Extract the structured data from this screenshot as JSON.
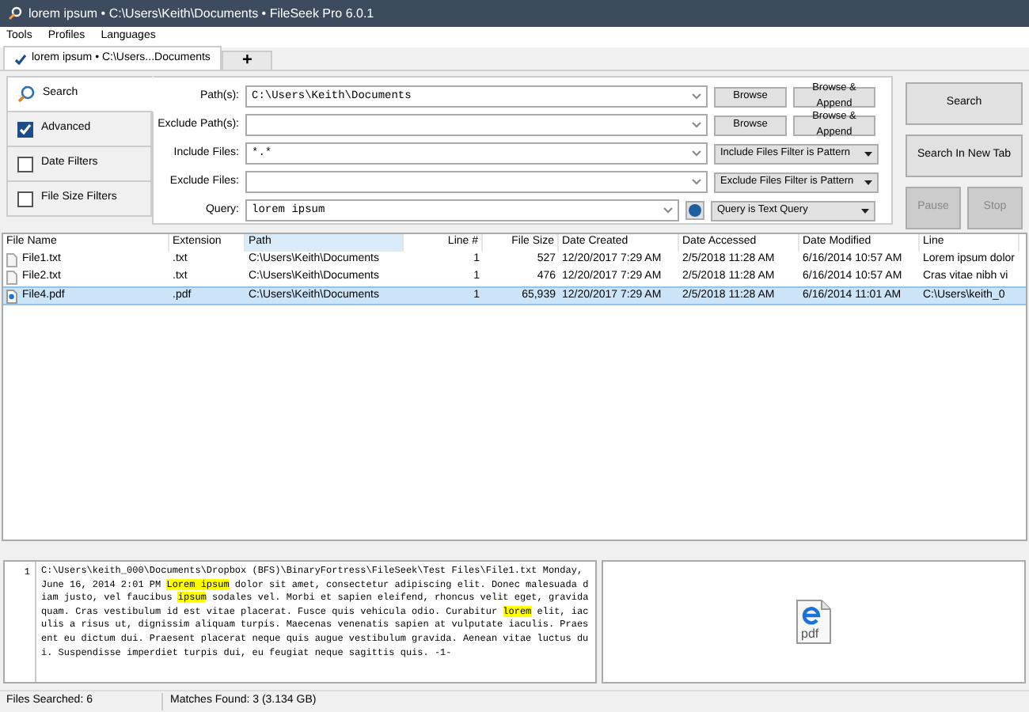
{
  "window": {
    "title": "lorem ipsum • C:\\Users\\Keith\\Documents • FileSeek Pro 6.0.1"
  },
  "menu": [
    "Tools",
    "Profiles",
    "Languages"
  ],
  "tabs": [
    {
      "label": "lorem ipsum • C:\\Users...Documents",
      "selected": true,
      "kind": "search"
    },
    {
      "label": "+",
      "selected": false,
      "kind": "add"
    }
  ],
  "sidebar": {
    "items": [
      {
        "label": "Search",
        "kind": "tab",
        "selected": true
      },
      {
        "label": "Advanced",
        "kind": "check",
        "checked": true
      },
      {
        "label": "Date Filters",
        "kind": "check",
        "checked": false
      },
      {
        "label": "File Size Filters",
        "kind": "check",
        "checked": false
      }
    ]
  },
  "fields": [
    {
      "label": "Path(s):",
      "value": "C:\\Users\\Keith\\Documents",
      "kind": "browse",
      "buttons": [
        "Browse",
        "Browse & Append"
      ]
    },
    {
      "label": "Exclude Path(s):",
      "kind": "browse",
      "buttons": [
        "Browse",
        "Browse & Append"
      ]
    },
    {
      "label": "Include Files:",
      "value": "*.*",
      "kind": "select",
      "option": "Include Files Filter is Pattern"
    },
    {
      "label": "Exclude Files:",
      "kind": "select",
      "option": "Exclude Files Filter is Pattern"
    },
    {
      "label": "Query:",
      "value": "lorem ipsum",
      "kind": "query",
      "option": "Query is Text Query"
    }
  ],
  "actions": [
    {
      "label": "Search",
      "disabled": false
    },
    {
      "label": "Search In New Tab",
      "disabled": false
    },
    {
      "label": "Pause",
      "disabled": true
    },
    {
      "label": "Stop",
      "disabled": true
    }
  ],
  "table": {
    "columns": [
      "File Name",
      "Extension",
      "Path",
      "Line #",
      "File Size",
      "Date Created",
      "Date Accessed",
      "Date Modified",
      "Line"
    ],
    "rows": [
      {
        "cells": [
          "File1.txt",
          ".txt",
          "C:\\Users\\Keith\\Documents",
          "1",
          "527",
          "12/20/2017 7:29 AM",
          "2/5/2018 11:28 AM",
          "6/16/2014 10:57 AM",
          "Lorem ipsum dolor"
        ],
        "kind": "text",
        "selected": false
      },
      {
        "cells": [
          "File2.txt",
          ".txt",
          "C:\\Users\\Keith\\Documents",
          "1",
          "476",
          "12/20/2017 7:29 AM",
          "2/5/2018 11:28 AM",
          "6/16/2014 10:57 AM",
          "Cras vitae nibh vi"
        ],
        "kind": "text",
        "selected": false
      },
      {
        "cells": [
          "File4.pdf",
          ".pdf",
          "C:\\Users\\Keith\\Documents",
          "1",
          "65,939",
          "12/20/2017 7:29 AM",
          "2/5/2018 11:28 AM",
          "6/16/2014 11:01 AM",
          "C:\\Users\\keith_0"
        ],
        "kind": "pdf",
        "selected": true
      }
    ]
  },
  "preview": {
    "line_number": "1",
    "file_icon_label": "pdf",
    "segments": [
      {
        "text": "C:\\Users\\keith_000\\Documents\\Dropbox (BFS)\\BinaryFortress\\FileSeek\\Test Files\\File1.txt Monday, June 16, 2014 2:01 PM ",
        "highlighted": false
      },
      {
        "text": "Lorem ipsum",
        "highlighted": true
      },
      {
        "text": " dolor sit amet, consectetur adipiscing elit. Donec malesuada diam justo, vel faucibus ",
        "highlighted": false
      },
      {
        "text": "ipsum",
        "highlighted": true
      },
      {
        "text": " sodales vel. Morbi et sapien eleifend, rhoncus velit eget, gravida quam. Cras vestibulum id est vitae placerat. Fusce quis vehicula odio. Curabitur ",
        "highlighted": false
      },
      {
        "text": "lorem",
        "highlighted": true
      },
      {
        "text": " elit, iaculis a risus ut, dignissim aliquam turpis. Maecenas venenatis sapien at vulputate iaculis. Praesent eu dictum dui. Praesent placerat neque quis augue vestibulum gravida. Aenean vitae luctus dui. Suspendisse imperdiet turpis dui, eu feugiat neque sagittis quis. -1-",
        "highlighted": false
      }
    ]
  },
  "status_bar": [
    "Files Searched: 6",
    "Matches Found: 3 (3.134 GB)"
  ]
}
